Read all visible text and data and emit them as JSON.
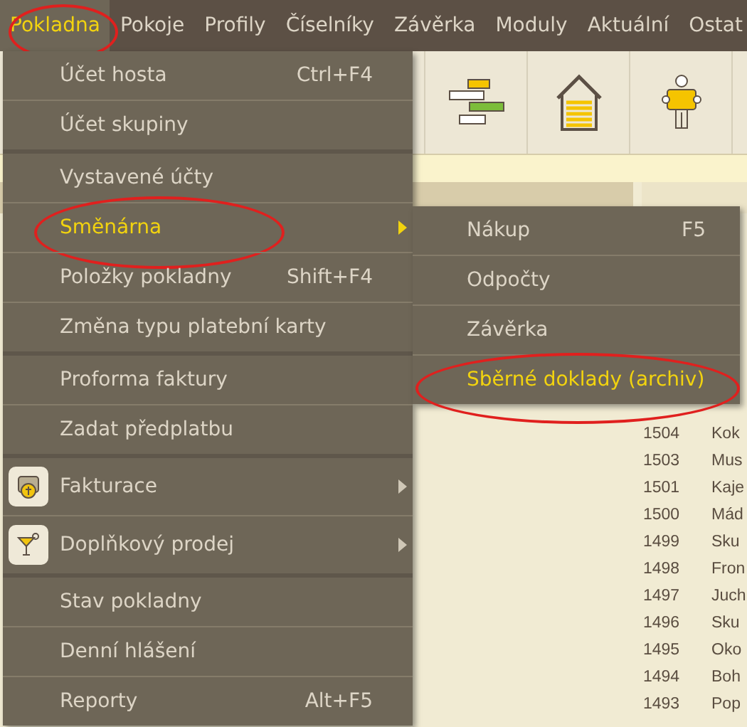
{
  "menubar": [
    {
      "label": "Pokladna",
      "selected": true,
      "circled": true
    },
    {
      "label": "Pokoje",
      "selected": false,
      "circled": false
    },
    {
      "label": "Profily",
      "selected": false,
      "circled": false
    },
    {
      "label": "Číselníky",
      "selected": false,
      "circled": false
    },
    {
      "label": "Závěrka",
      "selected": false,
      "circled": false
    },
    {
      "label": "Moduly",
      "selected": false,
      "circled": false
    },
    {
      "label": "Aktuální",
      "selected": false,
      "circled": false
    },
    {
      "label": "Ostat",
      "selected": false,
      "circled": false
    }
  ],
  "menu": [
    [
      {
        "label": "Účet hosta",
        "shortcut": "Ctrl+F4",
        "selected": false,
        "submenu": false,
        "circled": false
      },
      {
        "label": "Účet skupiny",
        "selected": false,
        "submenu": false,
        "circled": false
      }
    ],
    [
      {
        "label": "Vystavené účty",
        "selected": false,
        "submenu": false,
        "circled": false
      },
      {
        "label": "Směnárna",
        "selected": true,
        "submenu": true,
        "circled": true
      },
      {
        "label": "Položky pokladny",
        "shortcut": "Shift+F4",
        "selected": false,
        "submenu": false,
        "circled": false
      },
      {
        "label": "Změna typu platební karty",
        "selected": false,
        "submenu": false,
        "circled": false
      }
    ],
    [
      {
        "label": "Proforma faktury",
        "selected": false,
        "submenu": false,
        "circled": false
      },
      {
        "label": "Zadat předplatbu",
        "selected": false,
        "submenu": false,
        "circled": false
      }
    ],
    [
      {
        "label": "Fakturace",
        "kind": "icon",
        "selected": false,
        "submenu": true,
        "circled": false
      },
      {
        "label": "Doplňkový prodej",
        "kind": "icon",
        "selected": false,
        "submenu": true,
        "circled": false
      }
    ],
    [
      {
        "label": "Stav pokladny",
        "selected": false,
        "submenu": false,
        "circled": false
      },
      {
        "label": "Denní hlášení",
        "selected": false,
        "submenu": false,
        "circled": false
      },
      {
        "label": "Reporty",
        "shortcut": "Alt+F5",
        "selected": false,
        "submenu": false,
        "circled": false
      }
    ]
  ],
  "submenu": [
    {
      "label": "Nákup",
      "shortcut": "F5",
      "selected": false,
      "circled": false
    },
    {
      "label": "Odpočty",
      "selected": false,
      "circled": false
    },
    {
      "label": "Závěrka",
      "selected": false,
      "circled": false
    },
    {
      "label": "Sběrné doklady (archiv)",
      "selected": true,
      "circled": true
    }
  ],
  "rows": [
    {
      "number": "1504",
      "name": "Kok"
    },
    {
      "number": "1503",
      "name": "Mus"
    },
    {
      "number": "1501",
      "name": "Kaje"
    },
    {
      "number": "1500",
      "name": "Mád"
    },
    {
      "number": "1499",
      "name": "Sku"
    },
    {
      "number": "1498",
      "name": "Fron"
    },
    {
      "number": "1497",
      "name": "Juch"
    },
    {
      "number": "1496",
      "name": "Sku"
    },
    {
      "number": "1495",
      "name": "Oko"
    },
    {
      "number": "1494",
      "name": "Boh"
    },
    {
      "number": "1493",
      "name": "Pop"
    }
  ]
}
